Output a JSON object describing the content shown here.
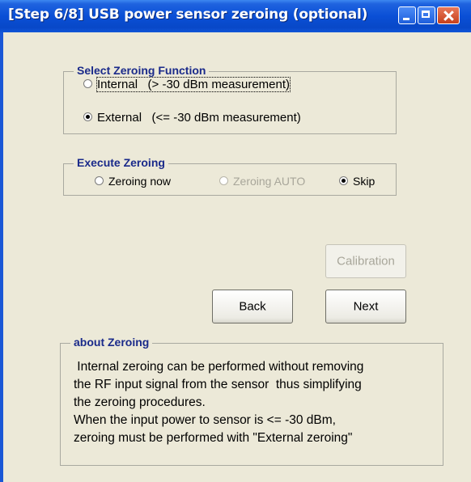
{
  "window": {
    "title": "[Step 6/8] USB power sensor zeroing (optional)",
    "controls": [
      "minimize-icon",
      "maximize-icon",
      "close-icon"
    ]
  },
  "select_zeroing": {
    "legend": "Select Zeroing Function",
    "options": [
      {
        "label": "Internal   (> -30 dBm measurement)",
        "selected": false
      },
      {
        "label": "External   (<= -30 dBm measurement)",
        "selected": true
      }
    ]
  },
  "execute_zeroing": {
    "legend": "Execute Zeroing",
    "options": [
      {
        "label": "Zeroing now",
        "selected": false,
        "enabled": true
      },
      {
        "label": "Zeroing AUTO",
        "selected": false,
        "enabled": false
      },
      {
        "label": "Skip",
        "selected": true,
        "enabled": true
      }
    ]
  },
  "buttons": {
    "calibration": "Calibration",
    "back": "Back",
    "next": "Next"
  },
  "about": {
    "legend": "about Zeroing",
    "lines": [
      " Internal zeroing can be performed without removing",
      "the RF input signal from the sensor  thus simplifying",
      "the zeroing procedures.",
      "When the input power to sensor is <= -30 dBm,",
      "zeroing must be performed with \"External zeroing\""
    ]
  }
}
